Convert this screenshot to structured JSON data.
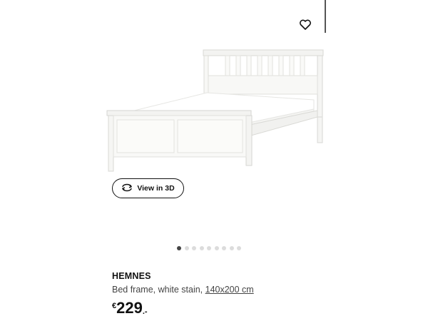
{
  "product": {
    "name": "HEMNES",
    "description_prefix": "Bed frame, white stain, ",
    "size_link": "140x200 cm",
    "price": {
      "currency": "€",
      "amount": "229",
      "decimals": ".-"
    }
  },
  "view3d": {
    "label": "View in 3D",
    "icon": "rotate-3d-icon"
  },
  "favorite": {
    "icon": "heart-icon"
  },
  "carousel": {
    "count": 9,
    "active_index": 0
  },
  "colors": {
    "text": "#111111",
    "muted": "#444444",
    "dot_inactive": "#dcdcdc",
    "dot_active": "#444444"
  }
}
